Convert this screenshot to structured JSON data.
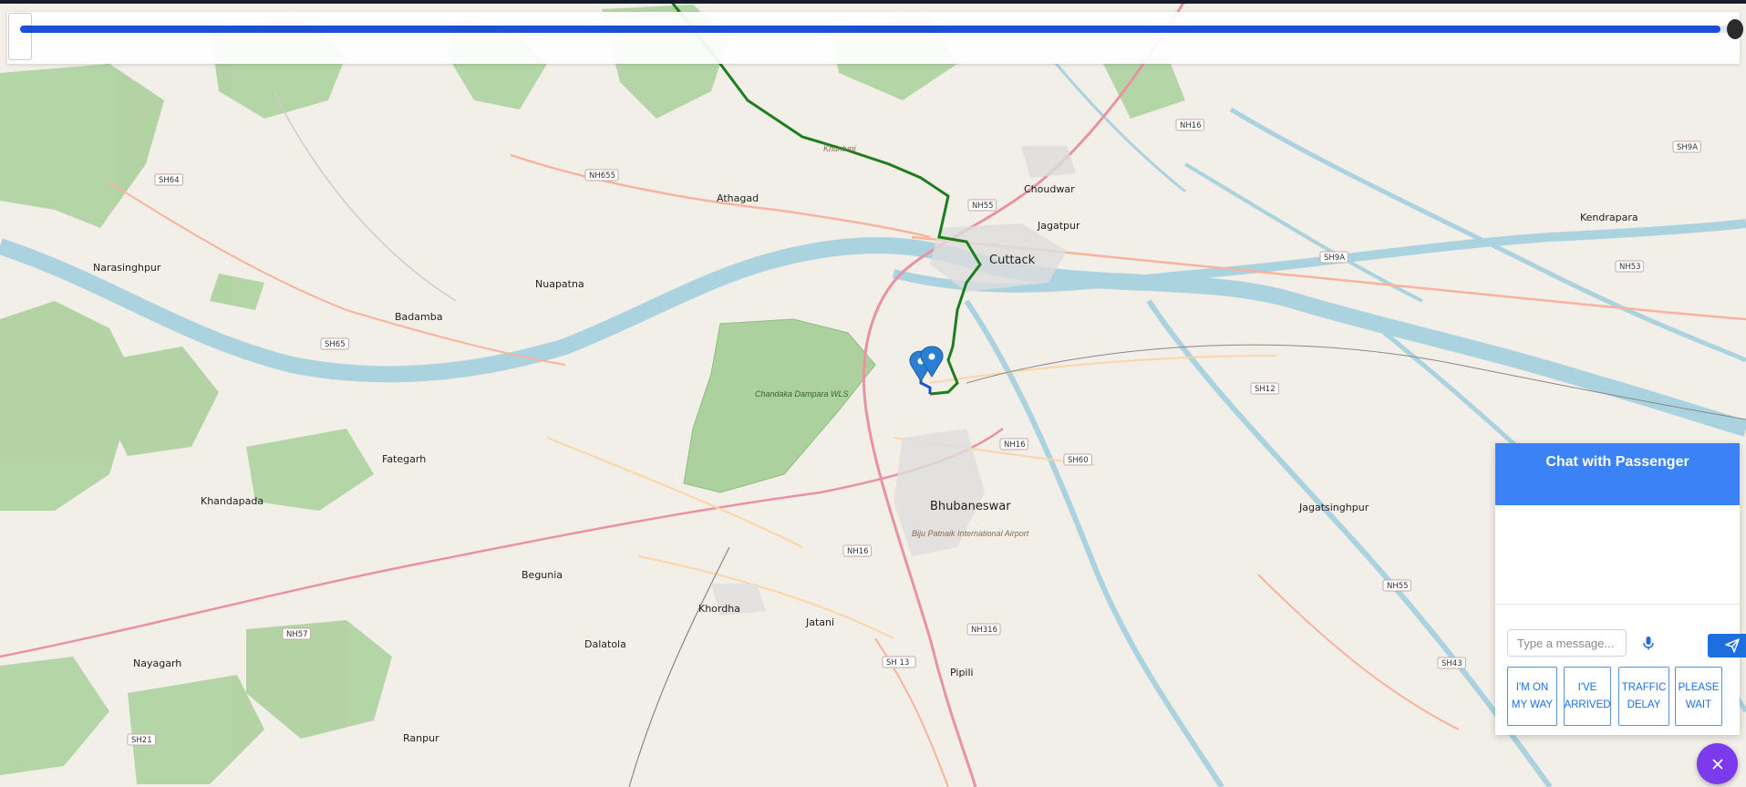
{
  "map": {
    "places": {
      "cuttack": "Cuttack",
      "bhubaneswar": "Bhubaneswar",
      "choudwar": "Choudwar",
      "jagatpur": "Jagatpur",
      "athagad": "Athagad",
      "narasinghpur": "Narasinghpur",
      "nuapatna": "Nuapatna",
      "badamba": "Badamba",
      "fategarh": "Fategarh",
      "khandapada": "Khandapada",
      "begunia": "Begunia",
      "khordha": "Khordha",
      "jatani": "Jatani",
      "dalatola": "Dalatola",
      "nayagarh": "Nayagarh",
      "rampur": "Ranpur",
      "pipili": "Pipili",
      "kendrapara": "Kendrapara",
      "jagatsinghpur": "Jagatsinghpur",
      "khuntuni": "Khuntuni",
      "chandaka": "Chandaka Dampara WLS",
      "airport": "Biju Patnaik International Airport"
    },
    "shields": [
      "NH16",
      "NH55",
      "NH655",
      "SH64",
      "SH65",
      "SH9A",
      "NH53",
      "SH12",
      "SH60",
      "NH16",
      "NH16",
      "NH316",
      "SH 13",
      "NH57",
      "SH21",
      "NH55",
      "SH43",
      "SH9A"
    ]
  },
  "progress": {
    "fraction": 0.995
  },
  "chat": {
    "title": "Chat with Passenger",
    "input_placeholder": "Type a message...",
    "mic_icon": "microphone-icon",
    "send_icon": "send-icon",
    "quick_replies": [
      "I'M ON MY WAY",
      "I'VE ARRIVED",
      "TRAFFIC DELAY",
      "PLEASE WAIT"
    ]
  },
  "colors": {
    "accent": "#3b82f6",
    "route_green": "#1e7d1e",
    "route_blue": "#1d4ed8",
    "fab": "#7c3aed"
  }
}
